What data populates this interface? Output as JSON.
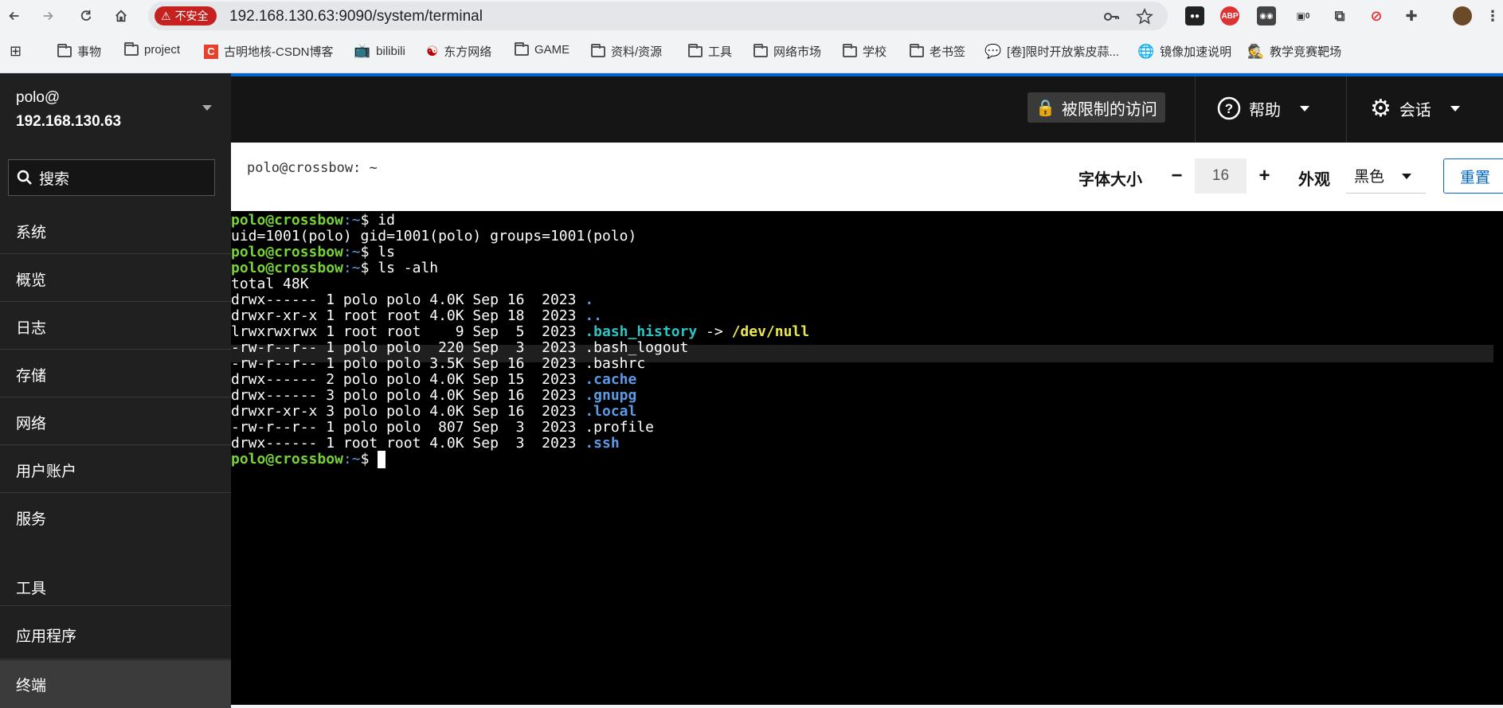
{
  "browser": {
    "security_label": "不安全",
    "url": "192.168.130.63:9090/system/terminal",
    "bookmarks": [
      "事物",
      "project",
      "古明地核-CSDN博客",
      "bilibili",
      "东方网络",
      "GAME",
      "资料/资源",
      "工具",
      "网络市场",
      "学校",
      "老书签",
      "[卷]限时开放紫皮蒜...",
      "镜像加速说明",
      "教学竞赛靶场"
    ],
    "extension_badge": "0"
  },
  "sidebar": {
    "user": "polo@",
    "host": "192.168.130.63",
    "search_placeholder": "搜索",
    "items": [
      "系统",
      "概览",
      "日志",
      "存储",
      "网络",
      "用户账户",
      "服务",
      "工具",
      "应用程序",
      "终端"
    ],
    "active": "终端"
  },
  "topbar": {
    "restricted": "被限制的访问",
    "help": "帮助",
    "session": "会话"
  },
  "toolbar": {
    "title": "polo@crossbow: ~",
    "font_size_label": "字体大小",
    "font_size_value": "16",
    "minus": "−",
    "plus": "+",
    "appearance_label": "外观",
    "appearance_value": "黑色",
    "reset": "重置"
  },
  "terminal": {
    "prompt_user": "polo@crossbow",
    "prompt_rest": ":~$ ",
    "lines": [
      {
        "type": "cmd",
        "cmd": "id"
      },
      {
        "type": "out",
        "text": "uid=1001(polo) gid=1001(polo) groups=1001(polo)"
      },
      {
        "type": "cmd",
        "cmd": "ls"
      },
      {
        "type": "cmd",
        "cmd": "ls -alh"
      },
      {
        "type": "out",
        "text": "total 48K"
      },
      {
        "type": "ls",
        "meta": "drwx------ 1 polo polo 4.0K Sep 16  2023 ",
        "name": ".",
        "style": "bb"
      },
      {
        "type": "ls",
        "meta": "drwxr-xr-x 1 root root 4.0K Sep 18  2023 ",
        "name": "..",
        "style": "bb"
      },
      {
        "type": "link",
        "meta": "lrwxrwxrwx 1 root root    9 Sep  5  2023 ",
        "name": ".bash_history",
        "arrow": " -> ",
        "target": "/dev/null"
      },
      {
        "type": "ls",
        "meta": "-rw-r--r-- 1 polo polo  220 Sep  3  2023 ",
        "name": ".bash_logout",
        "style": ""
      },
      {
        "type": "ls",
        "meta": "-rw-r--r-- 1 polo polo 3.5K Sep 16  2023 ",
        "name": ".bashrc",
        "style": ""
      },
      {
        "type": "ls",
        "meta": "drwx------ 2 polo polo 4.0K Sep 15  2023 ",
        "name": ".cache",
        "style": "bb"
      },
      {
        "type": "ls",
        "meta": "drwx------ 3 polo polo 4.0K Sep 16  2023 ",
        "name": ".gnupg",
        "style": "bb"
      },
      {
        "type": "ls",
        "meta": "drwxr-xr-x 3 polo polo 4.0K Sep 16  2023 ",
        "name": ".local",
        "style": "bb"
      },
      {
        "type": "ls",
        "meta": "-rw-r--r-- 1 polo polo  807 Sep  3  2023 ",
        "name": ".profile",
        "style": ""
      },
      {
        "type": "ls",
        "meta": "drwx------ 1 root root 4.0K Sep  3  2023 ",
        "name": ".ssh",
        "style": "bb"
      },
      {
        "type": "prompt"
      }
    ]
  },
  "colors": {
    "prompt": "#76d43a",
    "directory": "#5c9ae6",
    "symlink": "#2ec4c4",
    "link_target": "#e8e84a",
    "accent": "#0066cc",
    "insecure": "#c5221f"
  }
}
